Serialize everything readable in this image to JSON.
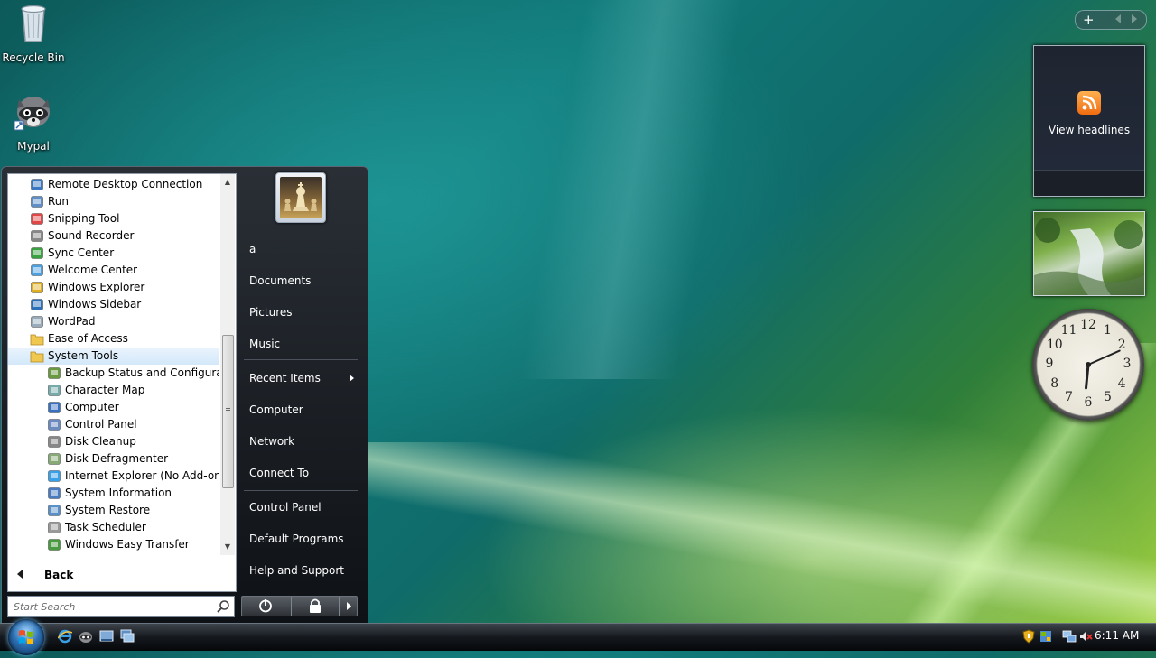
{
  "desktop": {
    "icons": [
      {
        "label": "Recycle Bin"
      },
      {
        "label": "Mypal"
      }
    ]
  },
  "start_menu": {
    "programs": [
      {
        "label": "Remote Desktop Connection",
        "level": 0
      },
      {
        "label": "Run",
        "level": 0
      },
      {
        "label": "Snipping Tool",
        "level": 0
      },
      {
        "label": "Sound Recorder",
        "level": 0
      },
      {
        "label": "Sync Center",
        "level": 0
      },
      {
        "label": "Welcome Center",
        "level": 0
      },
      {
        "label": "Windows Explorer",
        "level": 0
      },
      {
        "label": "Windows Sidebar",
        "level": 0
      },
      {
        "label": "WordPad",
        "level": 0
      },
      {
        "label": "Ease of Access",
        "level": 0
      },
      {
        "label": "System Tools",
        "level": 0,
        "selected": true
      },
      {
        "label": "Backup Status and Configuration",
        "level": 1
      },
      {
        "label": "Character Map",
        "level": 1
      },
      {
        "label": "Computer",
        "level": 1
      },
      {
        "label": "Control Panel",
        "level": 1
      },
      {
        "label": "Disk Cleanup",
        "level": 1
      },
      {
        "label": "Disk Defragmenter",
        "level": 1
      },
      {
        "label": "Internet Explorer (No Add-ons)",
        "level": 1
      },
      {
        "label": "System Information",
        "level": 1
      },
      {
        "label": "System Restore",
        "level": 1
      },
      {
        "label": "Task Scheduler",
        "level": 1
      },
      {
        "label": "Windows Easy Transfer",
        "level": 1
      }
    ],
    "back_label": "Back",
    "search_placeholder": "Start Search",
    "right_pane": {
      "user_name": "a",
      "items": [
        {
          "label": "Documents"
        },
        {
          "label": "Pictures"
        },
        {
          "label": "Music"
        },
        {
          "label": "Recent Items",
          "submenu": true
        },
        {
          "label": "Computer"
        },
        {
          "label": "Network"
        },
        {
          "label": "Connect To"
        },
        {
          "label": "Control Panel"
        },
        {
          "label": "Default Programs"
        },
        {
          "label": "Help and Support"
        }
      ]
    }
  },
  "sidebar": {
    "feed_label": "View headlines"
  },
  "clock": {
    "numbers": [
      "12",
      "1",
      "2",
      "3",
      "4",
      "5",
      "6",
      "7",
      "8",
      "9",
      "10",
      "11"
    ],
    "hour": 6,
    "minute": 11
  },
  "taskbar": {
    "time": "6:11 AM"
  },
  "colors": {
    "menu_selected": "#d3e8fa",
    "accent_orb": "#2c6fb2",
    "rss_orange": "#f06c10"
  }
}
